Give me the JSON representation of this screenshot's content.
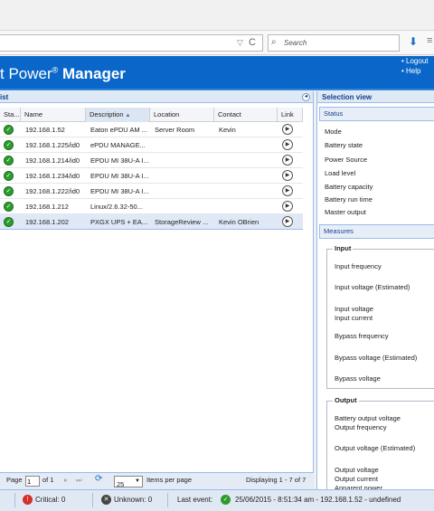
{
  "browser": {
    "search_placeholder": "Search",
    "url_dropdown_glyph": "▽",
    "refresh_glyph": "C",
    "download_glyph": "⬇",
    "menu_glyph": "≡"
  },
  "header": {
    "title_prefix": "t Power",
    "title_reg": "®",
    "title_suffix": "Manager",
    "logout_label": "• Logout",
    "help_label": "• Help"
  },
  "list": {
    "panel_title": "ist",
    "columns": {
      "status": "Sta...",
      "name": "Name",
      "description": "Description",
      "location": "Location",
      "contact": "Contact",
      "link": "Link"
    },
    "rows": [
      {
        "name": "192.168.1.52",
        "description": "Eaton ePDU AM ...",
        "location": "Server Room",
        "contact": "Kevin"
      },
      {
        "name": "192.168.1.225/id0",
        "description": "ePDU MANAGE...",
        "location": "",
        "contact": ""
      },
      {
        "name": "192.168.1.214/id0",
        "description": "EPDU MI 38U-A I...",
        "location": "",
        "contact": ""
      },
      {
        "name": "192.168.1.234/id0",
        "description": "EPDU MI 38U-A I...",
        "location": "",
        "contact": ""
      },
      {
        "name": "192.168.1.222/id0",
        "description": "EPDU MI 38U-A I...",
        "location": "",
        "contact": ""
      },
      {
        "name": "192.168.1.212",
        "description": "Linux/2.6.32-50...",
        "location": "",
        "contact": ""
      },
      {
        "name": "192.168.1.202",
        "description": "PXGX UPS + EA...",
        "location": "StorageReview ...",
        "contact": "Kevin OBrien"
      }
    ]
  },
  "pager": {
    "page_label": "Page",
    "page_value": "1",
    "of_label": "of 1",
    "page_size": "25",
    "items_per_page": "Items per page",
    "displaying": "Displaying 1 - 7 of 7"
  },
  "selection": {
    "title": "Selection view",
    "status_header": "Status",
    "status_items": [
      "Mode",
      "Battery state",
      "Power Source",
      "Load level",
      "Battery capacity",
      "Battery run time",
      "Master output"
    ],
    "measures_header": "Measures",
    "input_legend": "Input",
    "input_items": [
      "Input frequency",
      "Input voltage (Estimated)",
      "Input voltage",
      "Input current",
      "Bypass frequency",
      "Bypass voltage (Estimated)",
      "Bypass voltage"
    ],
    "output_legend": "Output",
    "output_items": [
      "Battery output voltage",
      "Output frequency",
      "Output voltage (Estimated)",
      "Output voltage",
      "Output current",
      "Apparent power"
    ]
  },
  "statusbar": {
    "critical": "Critical: 0",
    "unknown": "Unknown: 0",
    "last_event_label": "Last event:",
    "last_event_text": "25/06/2015 - 8:51:34 am - 192.168.1.52 - undefined"
  },
  "colors": {
    "header_blue": "#0a67c9",
    "ok_green": "#2c9c2c",
    "critical_red": "#d2302c"
  }
}
